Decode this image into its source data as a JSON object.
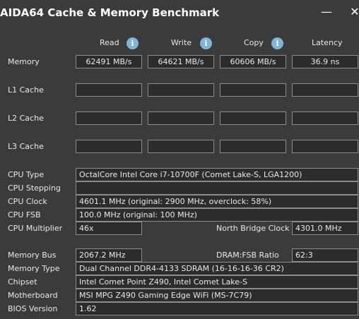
{
  "window": {
    "title": "AIDA64 Cache & Memory Benchmark",
    "minimize_glyph": "—",
    "close_glyph": "✕"
  },
  "columns": {
    "read": "Read",
    "write": "Write",
    "copy": "Copy",
    "latency": "Latency",
    "info_glyph": "i"
  },
  "rows": {
    "memory": {
      "label": "Memory",
      "read": "62491 MB/s",
      "write": "64621 MB/s",
      "copy": "60606 MB/s",
      "latency": "36.9 ns"
    },
    "l1": {
      "label": "L1 Cache",
      "read": "",
      "write": "",
      "copy": "",
      "latency": ""
    },
    "l2": {
      "label": "L2 Cache",
      "read": "",
      "write": "",
      "copy": "",
      "latency": ""
    },
    "l3": {
      "label": "L3 Cache",
      "read": "",
      "write": "",
      "copy": "",
      "latency": ""
    }
  },
  "system": {
    "cpu_type": {
      "label": "CPU Type",
      "value": "OctalCore Intel Core i7-10700F  (Comet Lake-S, LGA1200)"
    },
    "cpu_stepping": {
      "label": "CPU Stepping",
      "value": ""
    },
    "cpu_clock": {
      "label": "CPU Clock",
      "value": "4601.1 MHz  (original: 2900 MHz, overclock: 58%)"
    },
    "cpu_fsb": {
      "label": "CPU FSB",
      "value": "100.0 MHz  (original: 100 MHz)"
    },
    "cpu_multiplier": {
      "label": "CPU Multiplier",
      "value": "46x"
    },
    "north_bridge_clock": {
      "label": "North Bridge Clock",
      "value": "4301.0 MHz"
    },
    "memory_bus": {
      "label": "Memory Bus",
      "value": "2067.2 MHz"
    },
    "dram_fsb_ratio": {
      "label": "DRAM:FSB Ratio",
      "value": "62:3"
    },
    "memory_type": {
      "label": "Memory Type",
      "value": "Dual Channel DDR4-4133 SDRAM  (16-16-16-36 CR2)"
    },
    "chipset": {
      "label": "Chipset",
      "value": "Intel Comet Point Z490, Intel Comet Lake-S"
    },
    "motherboard": {
      "label": "Motherboard",
      "value": "MSI MPG Z490 Gaming Edge WiFi (MS-7C79)"
    },
    "bios_version": {
      "label": "BIOS Version",
      "value": "1.62"
    }
  },
  "colors": {
    "background": "#3b3b3b",
    "field_background": "#2c2c2c",
    "field_border": "#8c8c8c",
    "info_icon": "#7fb4d6"
  }
}
